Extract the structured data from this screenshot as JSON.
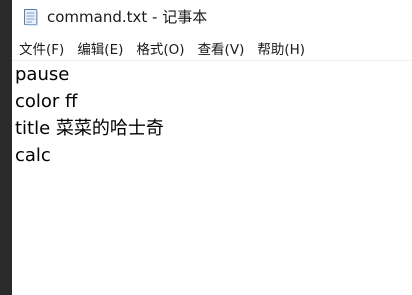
{
  "window": {
    "title": "command.txt - 记事本",
    "icon": "notepad-icon"
  },
  "menu": [
    {
      "label": "文件(F)"
    },
    {
      "label": "编辑(E)"
    },
    {
      "label": "格式(O)"
    },
    {
      "label": "查看(V)"
    },
    {
      "label": "帮助(H)"
    }
  ],
  "editor": {
    "lines": [
      "pause",
      "color ff",
      "title 菜菜的哈士奇",
      "calc"
    ]
  },
  "colors": {
    "background": "#ffffff",
    "text": "#000000",
    "window_edge": "#2a2a2a"
  }
}
